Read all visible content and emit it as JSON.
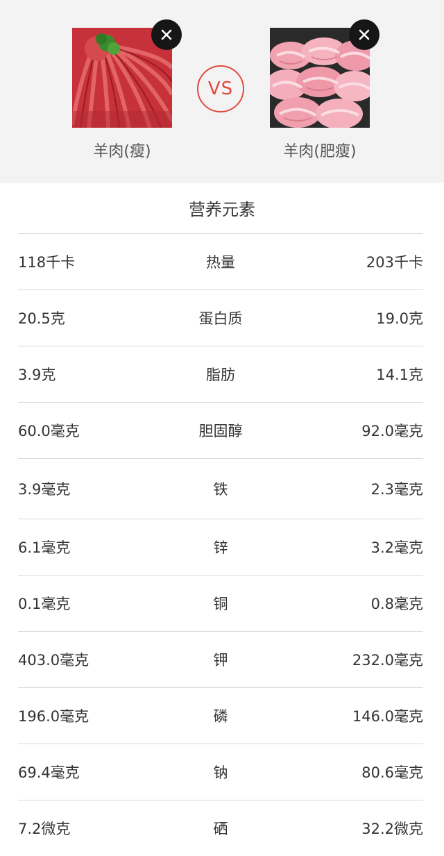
{
  "foods": {
    "left": {
      "name": "羊肉(瘦)",
      "image": "lean-mutton-slices-image"
    },
    "right": {
      "name": "羊肉(肥瘦)",
      "image": "mutton-rolls-image"
    },
    "vs_label": "VS",
    "remove_icon": "close-icon"
  },
  "section_title": "营养元素",
  "rows": [
    {
      "nutrient": "热量",
      "left": "118千卡",
      "right": "203千卡"
    },
    {
      "nutrient": "蛋白质",
      "left": "20.5克",
      "right": "19.0克"
    },
    {
      "nutrient": "脂肪",
      "left": "3.9克",
      "right": "14.1克"
    },
    {
      "nutrient": "胆固醇",
      "left": "60.0毫克",
      "right": "92.0毫克"
    },
    {
      "nutrient": "铁",
      "left": "3.9毫克",
      "right": "2.3毫克"
    },
    {
      "nutrient": "锌",
      "left": "6.1毫克",
      "right": "3.2毫克"
    },
    {
      "nutrient": "铜",
      "left": "0.1毫克",
      "right": "0.8毫克"
    },
    {
      "nutrient": "钾",
      "left": "403.0毫克",
      "right": "232.0毫克"
    },
    {
      "nutrient": "磷",
      "left": "196.0毫克",
      "right": "146.0毫克"
    },
    {
      "nutrient": "钠",
      "left": "69.4毫克",
      "right": "80.6毫克"
    },
    {
      "nutrient": "硒",
      "left": "7.2微克",
      "right": "32.2微克"
    }
  ],
  "colors": {
    "accent": "#e14a3f",
    "header_bg": "#f3f3f3",
    "divider": "#d9d9d9"
  }
}
